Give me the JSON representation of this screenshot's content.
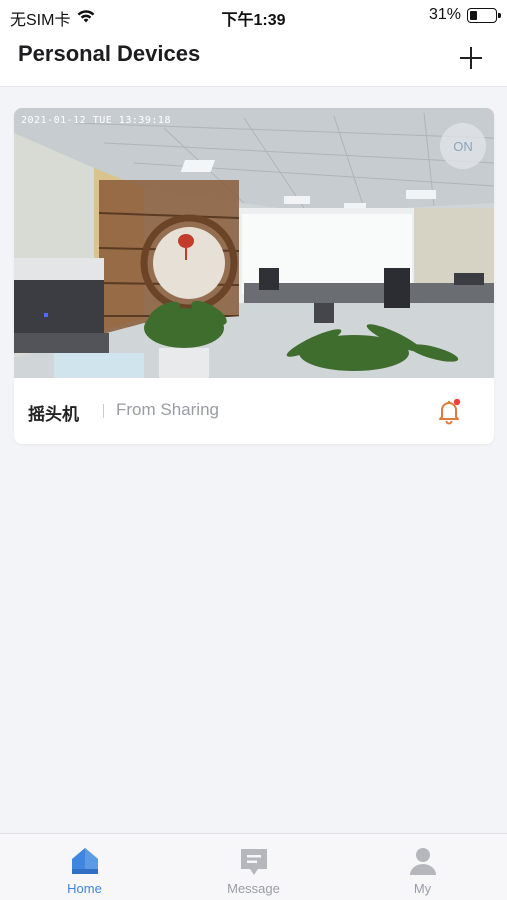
{
  "status_bar": {
    "carrier": "无SIM卡",
    "time": "下午1:39",
    "battery": "31%",
    "battery_level": 0.31
  },
  "header": {
    "title": "Personal Devices",
    "add_icon": "plus-icon"
  },
  "device": {
    "timestamp": "2021-01-12 TUE 13:39:18",
    "toggle_label": "ON",
    "name": "摇头机",
    "source": "From Sharing",
    "alert_icon": "bell-icon",
    "alert_badge_color": "#e8443a",
    "alert_icon_color": "#e07a3a"
  },
  "tabs": [
    {
      "label": "Home",
      "icon": "home-icon",
      "active": true
    },
    {
      "label": "Message",
      "icon": "message-icon",
      "active": false
    },
    {
      "label": "My",
      "icon": "user-icon",
      "active": false
    }
  ],
  "colors": {
    "accent": "#3f86e0",
    "inactive": "#9b9da4",
    "background": "#f3f4f8"
  }
}
